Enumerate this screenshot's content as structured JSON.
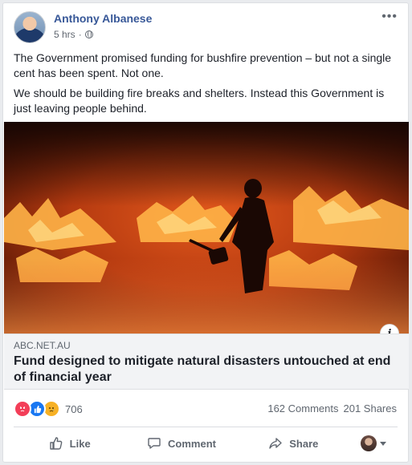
{
  "post": {
    "author": "Anthony Albanese",
    "time": "5 hrs",
    "separator": "·",
    "more_icon": "more-icon",
    "paragraphs": [
      "The Government promised funding for bushfire prevention – but not a single cent has been spent. Not one.",
      "We should be building fire breaks and shelters. Instead this Government is just leaving people behind."
    ]
  },
  "link": {
    "domain": "ABC.NET.AU",
    "title": "Fund designed to mitigate natural disasters untouched at end of financial year",
    "info_label": "i"
  },
  "stats": {
    "reaction_count": "706",
    "comments": "162 Comments",
    "shares": "201 Shares"
  },
  "actions": {
    "like": "Like",
    "comment": "Comment",
    "share": "Share"
  },
  "colors": {
    "author": "#385898",
    "like_blue": "#1877f2",
    "angry": "#f33e58",
    "sad": "#f7b125"
  }
}
